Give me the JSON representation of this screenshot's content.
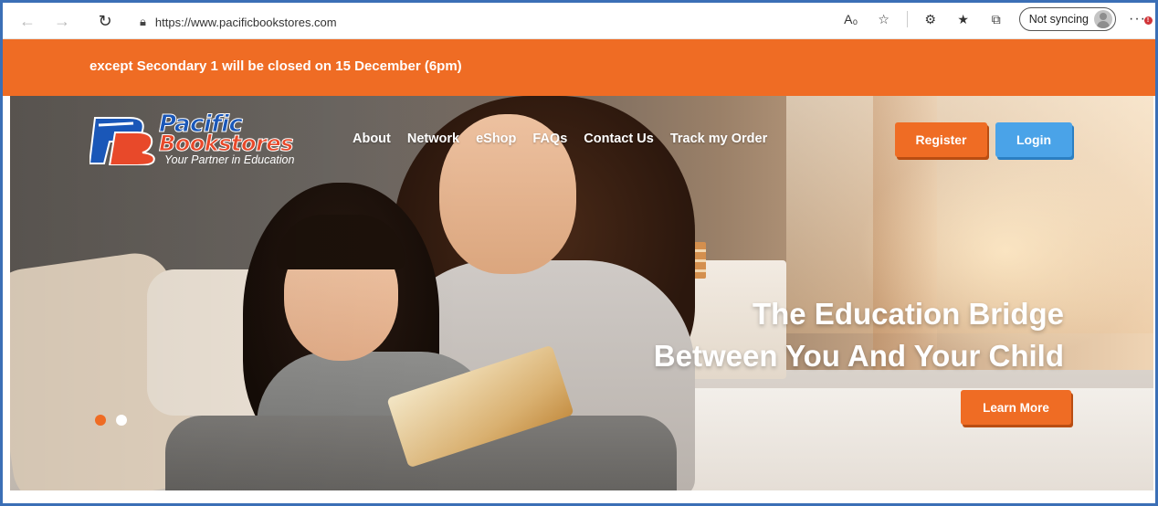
{
  "browser": {
    "url": "https://www.pacificbookstores.com",
    "sync_label": "Not syncing",
    "icons": [
      "back-icon",
      "forward-icon",
      "refresh-icon",
      "site-info-icon",
      "read-aloud-icon",
      "add-favorite-icon",
      "extensions-icon",
      "favorites-icon",
      "collections-icon",
      "profile-icon",
      "more-icon"
    ]
  },
  "announcement": {
    "text": "except Secondary 1 will be closed on 15 December (6pm)",
    "color": "#ef6c24"
  },
  "logo": {
    "name_line1": "Pacific",
    "name_line2": "Bookstores",
    "tagline": "Your Partner in Education"
  },
  "nav": {
    "items": [
      "About",
      "Network",
      "eShop",
      "FAQs",
      "Contact Us",
      "Track my Order"
    ]
  },
  "auth": {
    "register_label": "Register",
    "login_label": "Login",
    "register_color": "#ef6c24",
    "login_color": "#4aa3e8"
  },
  "hero": {
    "headline_line1": "The Education Bridge",
    "headline_line2": "Between You And Your Child",
    "cta_label": "Learn More",
    "slides": 2,
    "active_slide": 1
  }
}
